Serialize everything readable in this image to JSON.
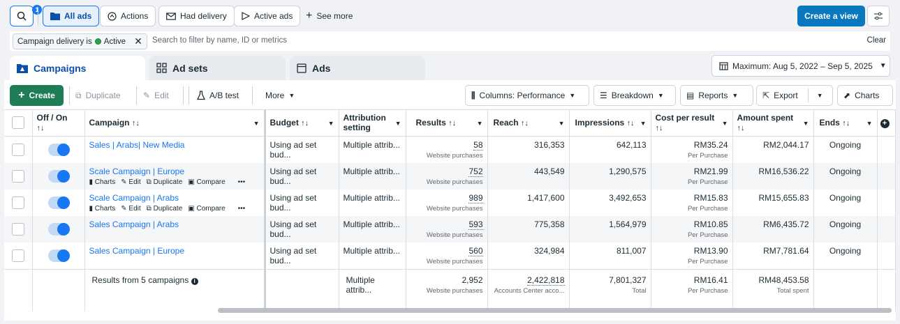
{
  "topbar": {
    "search_badge": "1",
    "filters": [
      "All ads",
      "Actions",
      "Had delivery",
      "Active ads"
    ],
    "see_more": "See more",
    "create_view": "Create a view"
  },
  "filterbar": {
    "chip_label": "Campaign delivery is",
    "chip_value": "Active",
    "placeholder": "Search to filter by name, ID or metrics",
    "clear": "Clear"
  },
  "tabs": [
    "Campaigns",
    "Ad sets",
    "Ads"
  ],
  "date_range": "Maximum: Aug 5, 2022 – Sep 5, 2025",
  "toolbar": {
    "create": "Create",
    "duplicate": "Duplicate",
    "edit": "Edit",
    "ab_test": "A/B test",
    "more": "More",
    "columns": "Columns: Performance",
    "breakdown": "Breakdown",
    "reports": "Reports",
    "export": "Export",
    "charts": "Charts"
  },
  "columns": {
    "off_on": "Off / On",
    "campaign": "Campaign",
    "budget": "Budget",
    "attribution": "Attribution setting",
    "results": "Results",
    "reach": "Reach",
    "impressions": "Impressions",
    "cost": "Cost per result",
    "spent": "Amount spent",
    "ends": "Ends"
  },
  "row_actions": [
    "Charts",
    "Edit",
    "Duplicate",
    "Compare"
  ],
  "rows": [
    {
      "name": "Sales | Arabs| New Media",
      "budget": "Using ad set bud...",
      "attribution": "Multiple attrib...",
      "results": "58",
      "results_sub": "Website purchases",
      "reach": "316,353",
      "impressions": "642,113",
      "cost": "RM35.24",
      "cost_sub": "Per Purchase",
      "spent": "RM2,044.17",
      "ends": "Ongoing"
    },
    {
      "name": "Scale Campaign | Europe",
      "budget": "Using ad set bud...",
      "attribution": "Multiple attrib...",
      "results": "752",
      "results_sub": "Website purchases",
      "reach": "443,549",
      "impressions": "1,290,575",
      "cost": "RM21.99",
      "cost_sub": "Per Purchase",
      "spent": "RM16,536.22",
      "ends": "Ongoing"
    },
    {
      "name": "Scale Campaign | Arabs",
      "budget": "Using ad set bud...",
      "attribution": "Multiple attrib...",
      "results": "989",
      "results_sub": "Website purchases",
      "reach": "1,417,600",
      "impressions": "3,492,653",
      "cost": "RM15.83",
      "cost_sub": "Per Purchase",
      "spent": "RM15,655.83",
      "ends": "Ongoing"
    },
    {
      "name": "Sales Campaign | Arabs",
      "budget": "Using ad set bud...",
      "attribution": "Multiple attrib...",
      "results": "593",
      "results_sub": "Website purchases",
      "reach": "775,358",
      "impressions": "1,564,979",
      "cost": "RM10.85",
      "cost_sub": "Per Purchase",
      "spent": "RM6,435.72",
      "ends": "Ongoing"
    },
    {
      "name": "Sales Campaign | Europe",
      "budget": "Using ad set bud...",
      "attribution": "Multiple attrib...",
      "results": "560",
      "results_sub": "Website purchases",
      "reach": "324,984",
      "impressions": "811,007",
      "cost": "RM13.90",
      "cost_sub": "Per Purchase",
      "spent": "RM7,781.64",
      "ends": "Ongoing"
    }
  ],
  "summary": {
    "label": "Results from 5 campaigns",
    "attribution": "Multiple attrib...",
    "results": "2,952",
    "results_sub": "Website purchases",
    "reach": "2,422,818",
    "reach_sub": "Accounts Center acco...",
    "impressions": "7,801,327",
    "impressions_sub": "Total",
    "cost": "RM16.41",
    "cost_sub": "Per Purchase",
    "spent": "RM48,453.58",
    "spent_sub": "Total spent"
  },
  "colors": {
    "primary": "#1877f2",
    "create_view": "#0a78be",
    "create": "#1e7d56",
    "active_dot": "#31a24c"
  }
}
